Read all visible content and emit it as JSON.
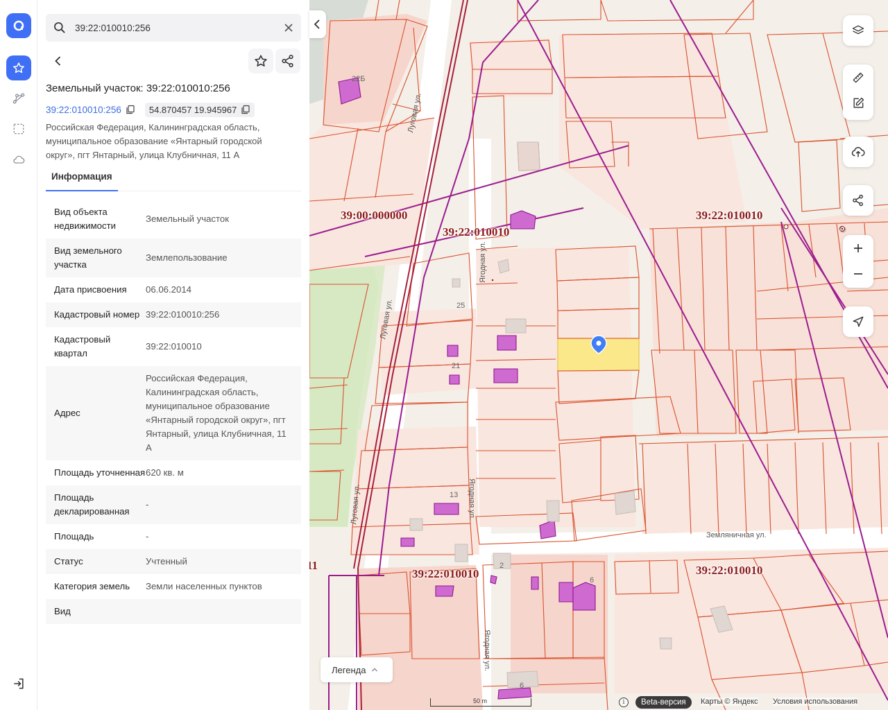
{
  "search": {
    "value": "39:22:010010:256"
  },
  "object": {
    "title": "Земельный участок: 39:22:010010:256",
    "cadastral_link": "39:22:010010:256",
    "coordinates": "54.870457 19.945967",
    "address": "Российская Федерация, Калининградская область, муниципальное образование «Янтарный городской округ», пгт Янтарный, улица Клубничная, 11 А"
  },
  "tabs": {
    "info": "Информация"
  },
  "info_rows": [
    {
      "key": "Вид объекта недвижимости",
      "value": "Земельный участок"
    },
    {
      "key": "Вид земельного участка",
      "value": "Землепользование"
    },
    {
      "key": "Дата присвоения",
      "value": "06.06.2014"
    },
    {
      "key": "Кадастровый номер",
      "value": "39:22:010010:256"
    },
    {
      "key": "Кадастровый квартал",
      "value": "39:22:010010"
    },
    {
      "key": "Адрес",
      "value": "Российская Федерация, Калининградская область, муниципальное образование «Янтарный городской округ», пгт Янтарный, улица Клубничная, 11 А"
    },
    {
      "key": "Площадь уточненная",
      "value": "620 кв. м"
    },
    {
      "key": "Площадь декларированная",
      "value": "-"
    },
    {
      "key": "Площадь",
      "value": "-"
    },
    {
      "key": "Статус",
      "value": "Учтенный"
    },
    {
      "key": "Категория земель",
      "value": "Земли населенных пунктов"
    },
    {
      "key": "Вид",
      "value": ""
    }
  ],
  "map": {
    "quarter_labels": [
      "39:00:000000",
      "39:22:010010",
      "39:22:010010",
      "39:22:010010",
      "39:22:010010",
      "11"
    ],
    "streets": [
      "Луговая ул.",
      "Луговая ул.",
      "Луговая ул.",
      "Ягодная ул.",
      "Ягодная ул.",
      "Ягодная ул.",
      "Земляничная ул."
    ],
    "house_numbers": [
      "22Б",
      "25",
      "21",
      "13",
      "2",
      "6",
      "6"
    ],
    "legend": "Легенда",
    "scale": "50 m",
    "beta": "Beta-версия",
    "copyright": "Карты © Яндекс",
    "terms": "Условия использования",
    "info_glyph": "i"
  },
  "colors": {
    "accent": "#3f6ff4",
    "parcel_line": "#d9502c",
    "boundary": "#8e1a8e",
    "highlight": "#fbe88a"
  }
}
